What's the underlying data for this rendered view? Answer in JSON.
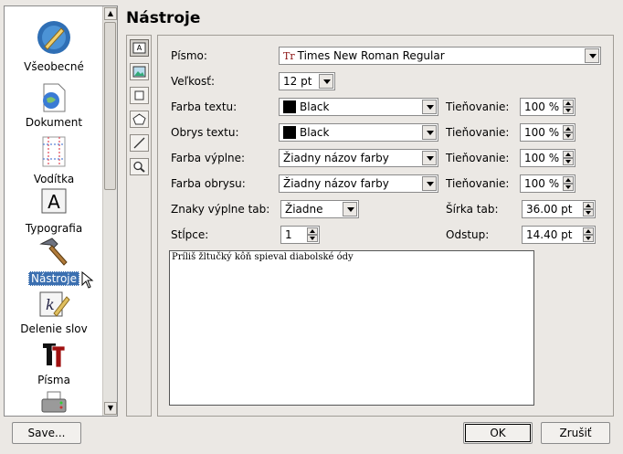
{
  "page_title": "Nástroje",
  "sidebar": {
    "items": [
      {
        "label": "Všeobecné",
        "icon": "general-prefs-icon"
      },
      {
        "label": "Dokument",
        "icon": "document-icon"
      },
      {
        "label": "Vodítka",
        "icon": "guides-icon"
      },
      {
        "label": "Typografia",
        "icon": "typography-icon"
      },
      {
        "label": "Nástroje",
        "icon": "hammer-icon",
        "selected": true
      },
      {
        "label": "Delenie slov",
        "icon": "hyphenation-icon"
      },
      {
        "label": "Písma",
        "icon": "fonts-icon"
      },
      {
        "label": "",
        "icon": "printer-icon"
      }
    ]
  },
  "tools": [
    "text-frame-tool-icon",
    "image-frame-tool-icon",
    "rectangle-tool-icon",
    "polygon-tool-icon",
    "line-tool-icon",
    "zoom-tool-icon"
  ],
  "form": {
    "font_label": "Písmo:",
    "font_value": "Times New Roman Regular",
    "size_label": "Veľkosť:",
    "size_value": "12 pt",
    "text_color_label": "Farba textu:",
    "text_color_value": "Black",
    "text_stroke_label": "Obrys textu:",
    "text_stroke_value": "Black",
    "fill_color_label": "Farba výplne:",
    "fill_color_value": "Žiadny názov farby",
    "line_color_label": "Farba obrysu:",
    "line_color_value": "Žiadny názov farby",
    "shade_label": "Tieňovanie:",
    "shade_1": "100 %",
    "shade_2": "100 %",
    "shade_3": "100 %",
    "shade_4": "100 %",
    "tab_fill_label": "Znaky výplne tab:",
    "tab_fill_value": "Žiadne",
    "tab_width_label": "Šírka tab:",
    "tab_width_value": "36.00 pt",
    "columns_label": "Stĺpce:",
    "columns_value": "1",
    "gap_label": "Odstup:",
    "gap_value": "14.40 pt",
    "preview_text": "Príliš žltučký kôň spieval diabolské ódy"
  },
  "buttons": {
    "save": "Save...",
    "ok": "OK",
    "cancel": "Zrušiť"
  }
}
